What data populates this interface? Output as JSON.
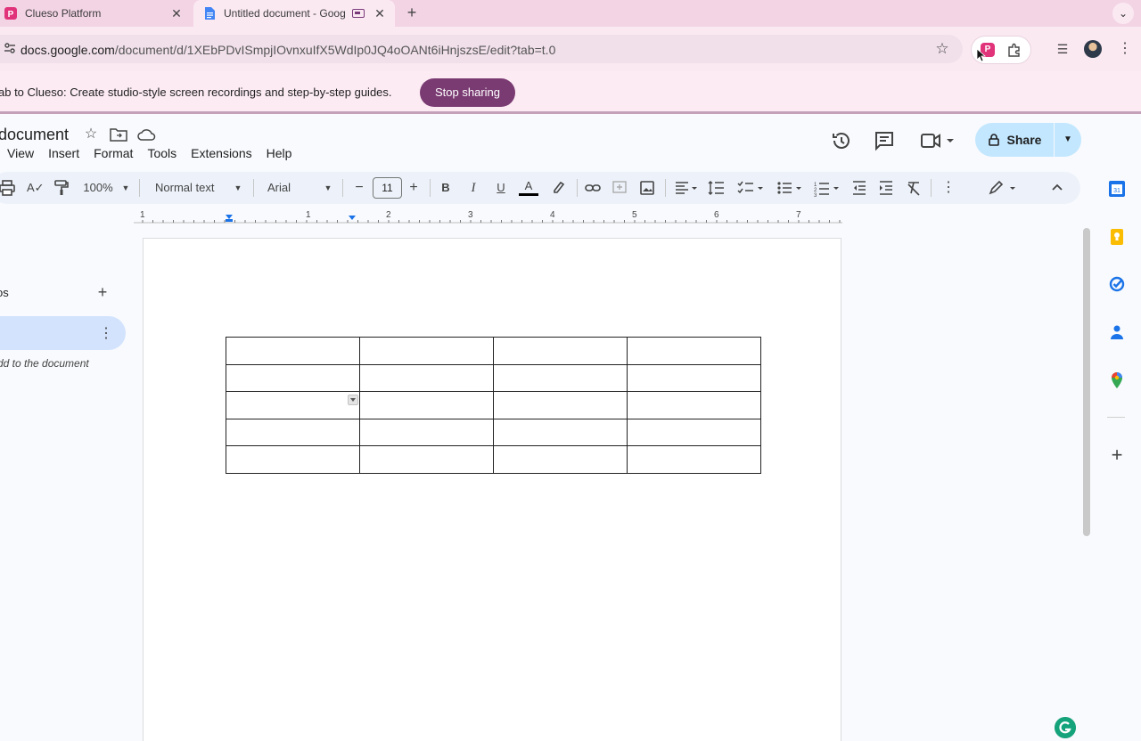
{
  "browser": {
    "tabs": [
      {
        "title": "Clueso Platform",
        "active": false
      },
      {
        "title": "Untitled document - Goog",
        "active": true
      }
    ],
    "new_tab": "+",
    "tab_menu": "⌄",
    "address": {
      "host": "docs.google.com",
      "path": "/document/d/1XEbPDvISmpjIOvnxuIfX5WdIp0JQ4oOANt6iHnjszsE/edit?tab=t.0"
    }
  },
  "share_banner": {
    "text": "ab to Clueso: Create studio-style screen recordings and step-by-step guides.",
    "stop_label": "Stop sharing"
  },
  "docs": {
    "title": "document",
    "menus": [
      "View",
      "Insert",
      "Format",
      "Tools",
      "Extensions",
      "Help"
    ],
    "share_label": "Share",
    "toolbar": {
      "zoom": "100%",
      "style": "Normal text",
      "font": "Arial",
      "font_size": "11",
      "bold": "B",
      "italic": "I",
      "underline": "U",
      "text_color": "A",
      "minus": "−",
      "plus": "+"
    },
    "ruler_numbers": [
      "1",
      "1",
      "1",
      "2",
      "3",
      "4",
      "5",
      "6",
      "7"
    ],
    "tabs_panel": {
      "heading": "os",
      "add": "+",
      "hint_line1": "dd to the document",
      "hint_line2": "."
    },
    "table": {
      "rows": 5,
      "cols": 4
    }
  },
  "colors": {
    "tab_strip": "#f3d4e4",
    "stop_button": "#7a3a72",
    "share_button": "#c2e7ff",
    "active_side_tab": "#d3e3fd"
  }
}
